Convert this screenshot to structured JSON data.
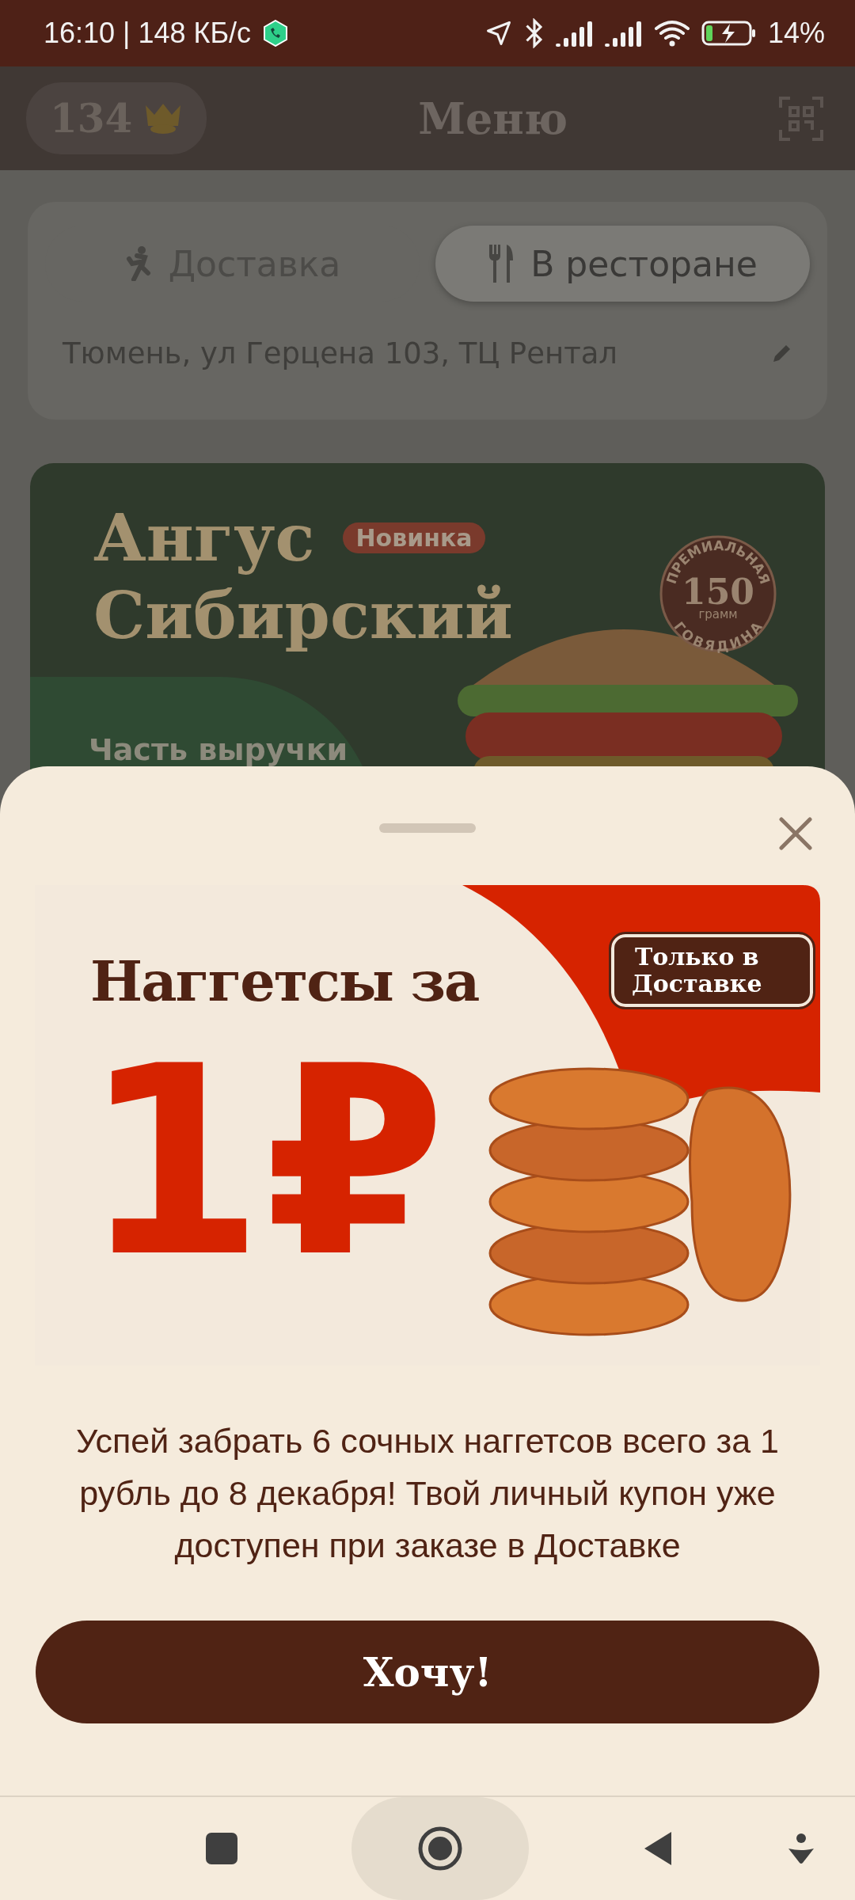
{
  "status_bar": {
    "time_speed": "16:10 | 148 КБ/с",
    "battery_percent": "14%"
  },
  "header": {
    "points": "134",
    "title": "Меню"
  },
  "order_modes": [
    {
      "label": "Доставка",
      "kind": "delivery",
      "selected": false
    },
    {
      "label": "В ресторане",
      "kind": "restaurant",
      "selected": true
    }
  ],
  "address": "Тюмень, ул Герцена 103, ТЦ Рентал",
  "banner": {
    "title_lines": [
      "Ангус",
      "Сибирский"
    ],
    "badge": "Новинка",
    "caption": "Часть выручки",
    "seal_top": "ПРЕМИАЛЬНАЯ",
    "seal_number": "150",
    "seal_unit": "грамм",
    "seal_bottom": "ГОВЯДИНА"
  },
  "sheet": {
    "promo": {
      "headline": "Наггетсы за",
      "price": "1₽",
      "tag_lines": [
        "Только в",
        "Доставке"
      ]
    },
    "description": "Успей забрать 6 сочных наггетсов всего за 1 рубль до 8 декабря! Твой личный купон уже доступен при заказе в Доставке",
    "button": "Хочу!"
  }
}
